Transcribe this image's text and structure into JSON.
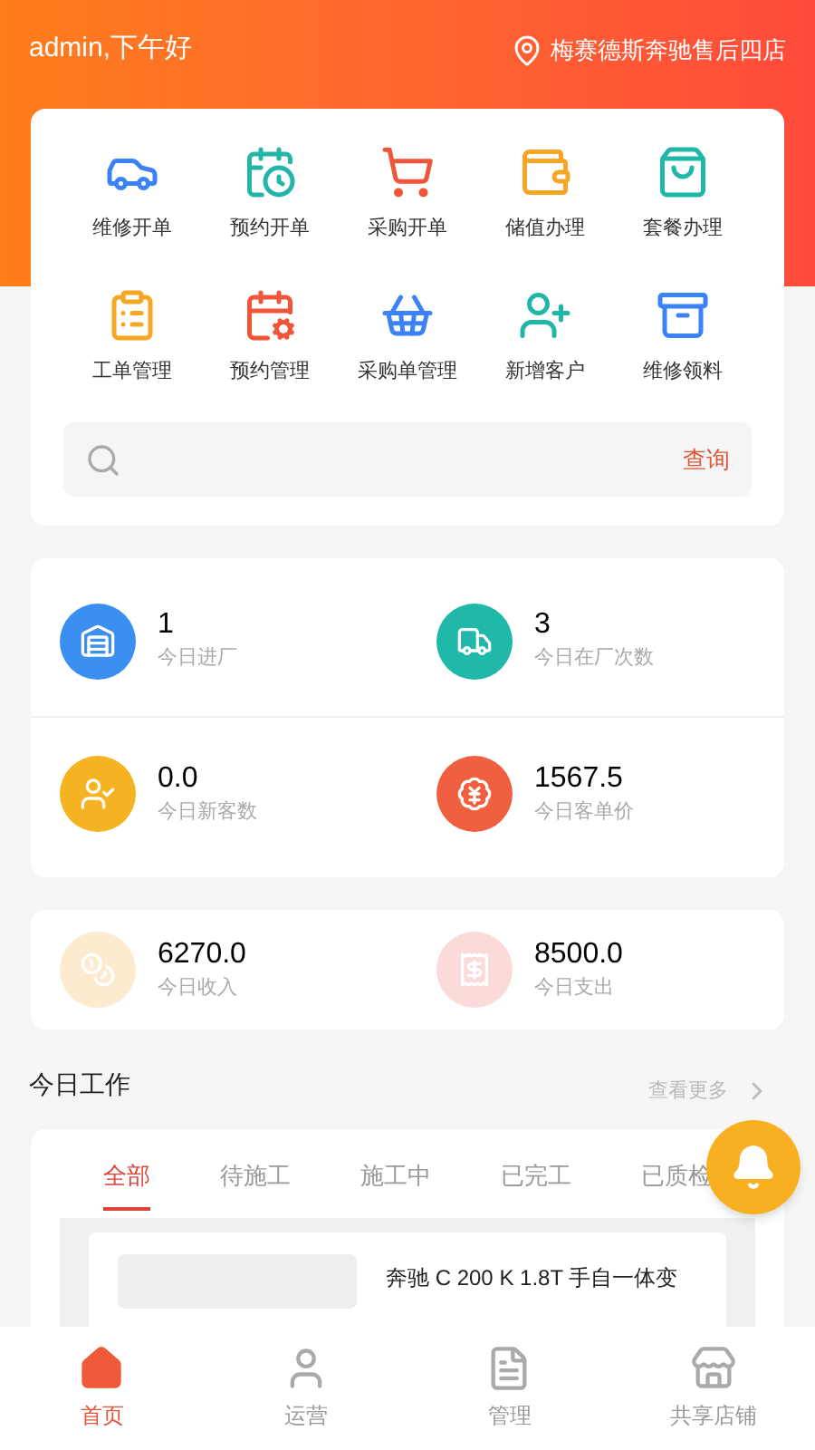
{
  "header": {
    "greeting": "admin,下午好",
    "store": "梅赛德斯奔驰售后四店"
  },
  "shortcuts": [
    {
      "label": "维修开单"
    },
    {
      "label": "预约开单"
    },
    {
      "label": "采购开单"
    },
    {
      "label": "储值办理"
    },
    {
      "label": "套餐办理"
    },
    {
      "label": "工单管理"
    },
    {
      "label": "预约管理"
    },
    {
      "label": "采购单管理"
    },
    {
      "label": "新增客户"
    },
    {
      "label": "维修领料"
    }
  ],
  "search": {
    "button": "查询"
  },
  "stats": [
    {
      "value": "1",
      "label": "今日进厂"
    },
    {
      "value": "3",
      "label": "今日在厂次数"
    },
    {
      "value": "0.0",
      "label": "今日新客数"
    },
    {
      "value": "1567.5",
      "label": "今日客单价"
    }
  ],
  "finance": [
    {
      "value": "6270.0",
      "label": "今日收入"
    },
    {
      "value": "8500.0",
      "label": "今日支出"
    }
  ],
  "work": {
    "title": "今日工作",
    "more": "查看更多",
    "tabs": [
      {
        "label": "全部",
        "selected": true
      },
      {
        "label": "待施工",
        "selected": false
      },
      {
        "label": "施工中",
        "selected": false
      },
      {
        "label": "已完工",
        "selected": false
      },
      {
        "label": "已质检",
        "selected": false
      }
    ],
    "item": {
      "title": "奔驰 C 200 K 1.8T 手自一体变"
    }
  },
  "nav": [
    {
      "label": "首页",
      "selected": true
    },
    {
      "label": "运营",
      "selected": false
    },
    {
      "label": "管理",
      "selected": false
    },
    {
      "label": "共享店铺",
      "selected": false
    }
  ]
}
